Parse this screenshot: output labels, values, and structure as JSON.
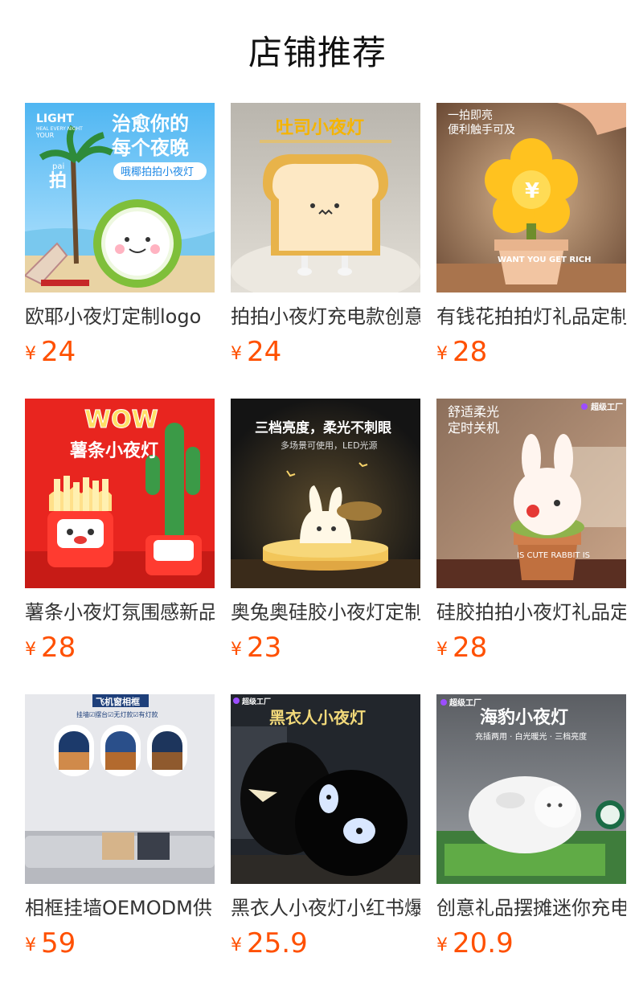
{
  "header": {
    "title": "店铺推荐"
  },
  "products": [
    {
      "name": "欧耶小夜灯定制logo",
      "currency": "¥",
      "price": "24",
      "image": {
        "text_1": "LIGHT",
        "text_2": "HEAL EVERY NIGHT",
        "text_3": "YOUR",
        "text_4": "pai",
        "text_5": "拍",
        "text_6": "治愈你的",
        "text_7": "每个夜晚",
        "text_8": "哦椰拍拍小夜灯"
      }
    },
    {
      "name": "拍拍小夜灯充电款创意",
      "currency": "¥",
      "price": "24",
      "image": {
        "text_1": "吐司小夜灯"
      }
    },
    {
      "name": "有钱花拍拍灯礼品定制",
      "currency": "¥",
      "price": "28",
      "image": {
        "text_1": "一拍即亮",
        "text_2": "便利触手可及",
        "text_3": "¥",
        "text_4": "WANT YOU GET RICH"
      }
    },
    {
      "name": "薯条小夜灯氛围感新品",
      "currency": "¥",
      "price": "28",
      "image": {
        "text_1": "WOW",
        "text_2": "薯条小夜灯"
      }
    },
    {
      "name": "奥兔奥硅胶小夜灯定制",
      "currency": "¥",
      "price": "23",
      "image": {
        "text_1": "三档亮度，柔光不刺眼",
        "text_2": "多场景可使用，LED光源"
      }
    },
    {
      "name": "硅胶拍拍小夜灯礼品定",
      "currency": "¥",
      "price": "28",
      "image": {
        "text_1": "舒适柔光",
        "text_2": "定时关机",
        "text_3": "超级工厂",
        "text_4": "IS CUTE RABBIT IS"
      }
    },
    {
      "name": "相框挂墙OEMODM供",
      "currency": "¥",
      "price": "59",
      "image": {
        "text_1": "飞机窗相框",
        "text_2": "挂墙☑摆台☑无灯款☑有灯款"
      }
    },
    {
      "name": "黑衣人小夜灯小红书爆",
      "currency": "¥",
      "price": "25.9",
      "image": {
        "text_1": "超级工厂",
        "text_2": "黑衣人小夜灯"
      }
    },
    {
      "name": "创意礼品摆摊迷你充电",
      "currency": "¥",
      "price": "20.9",
      "image": {
        "text_1": "超级工厂",
        "text_2": "海豹小夜灯",
        "text_3": "充插两用 · 白光暖光 · 三档亮度"
      }
    }
  ]
}
